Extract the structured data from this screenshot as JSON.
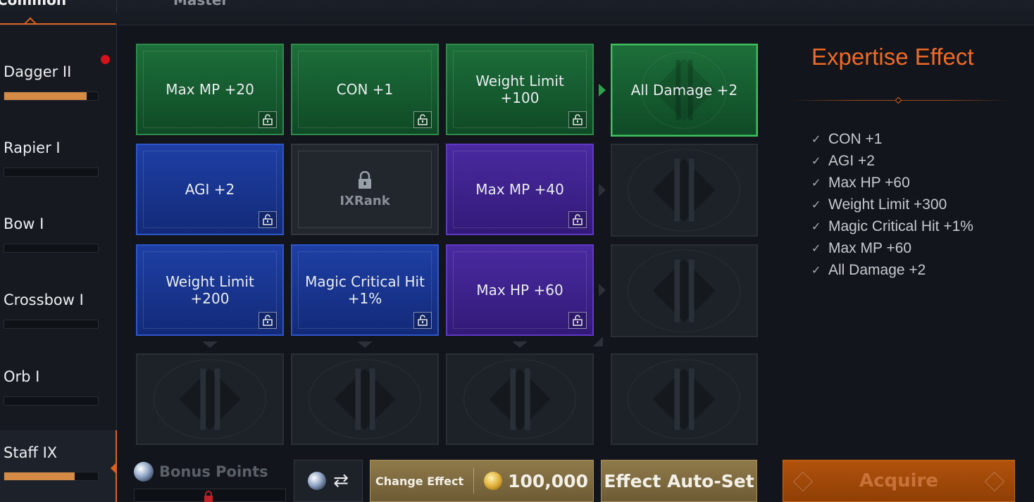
{
  "tabs": [
    {
      "label": "Common",
      "active": true
    },
    {
      "label": "Master",
      "active": false
    }
  ],
  "sidebar": {
    "items": [
      {
        "label": "Dagger II",
        "progress": 0.88,
        "notification": true
      },
      {
        "label": "Rapier Ⅰ",
        "progress": 0
      },
      {
        "label": "Bow Ⅰ",
        "progress": 0
      },
      {
        "label": "Crossbow Ⅰ",
        "progress": 0
      },
      {
        "label": "Orb Ⅰ",
        "progress": 0
      },
      {
        "label": "Staff IX",
        "progress": 0.75,
        "active": true
      }
    ]
  },
  "grid": {
    "row1": {
      "c1": {
        "line1": "Max MP  +20",
        "line2": ""
      },
      "c2": {
        "line1": "CON  +1",
        "line2": ""
      },
      "c3": {
        "line1": "Weight Limit",
        "line2": "+100"
      },
      "c4": {
        "line1": "All Damage  +2",
        "line2": ""
      }
    },
    "row2": {
      "c1": {
        "line1": "AGI  +2",
        "line2": ""
      },
      "c2": {
        "rank_label": "IXRank"
      },
      "c3": {
        "line1": "Max MP  +40",
        "line2": ""
      }
    },
    "row3": {
      "c1": {
        "line1": "Weight Limit",
        "line2": "+200"
      },
      "c2": {
        "line1": "Magic Critical Hit",
        "line2": "+1%"
      },
      "c3": {
        "line1": "Max HP  +60",
        "line2": ""
      }
    }
  },
  "effects": {
    "title": "Expertise Effect",
    "items": [
      "CON +1",
      "AGI +2",
      "Max HP +60",
      "Weight Limit +300",
      "Magic Critical Hit +1%",
      "Max MP +60",
      "All Damage +2"
    ]
  },
  "bottom": {
    "bonus_label": "Bonus Points",
    "swap_icon": "⇄",
    "change_effect_label": "Change Effect",
    "change_effect_cost": "100,000",
    "auto_set_label": "Effect Auto-Set",
    "acquire_label": "Acquire"
  },
  "colors": {
    "accent": "#ef6a26",
    "green_tier": "#1d6f3a",
    "blue_tier": "#1e3fa5",
    "purple_tier": "#4a2aa0",
    "gold_button": "#8f7a4a",
    "acquire_button": "#b1520c"
  }
}
